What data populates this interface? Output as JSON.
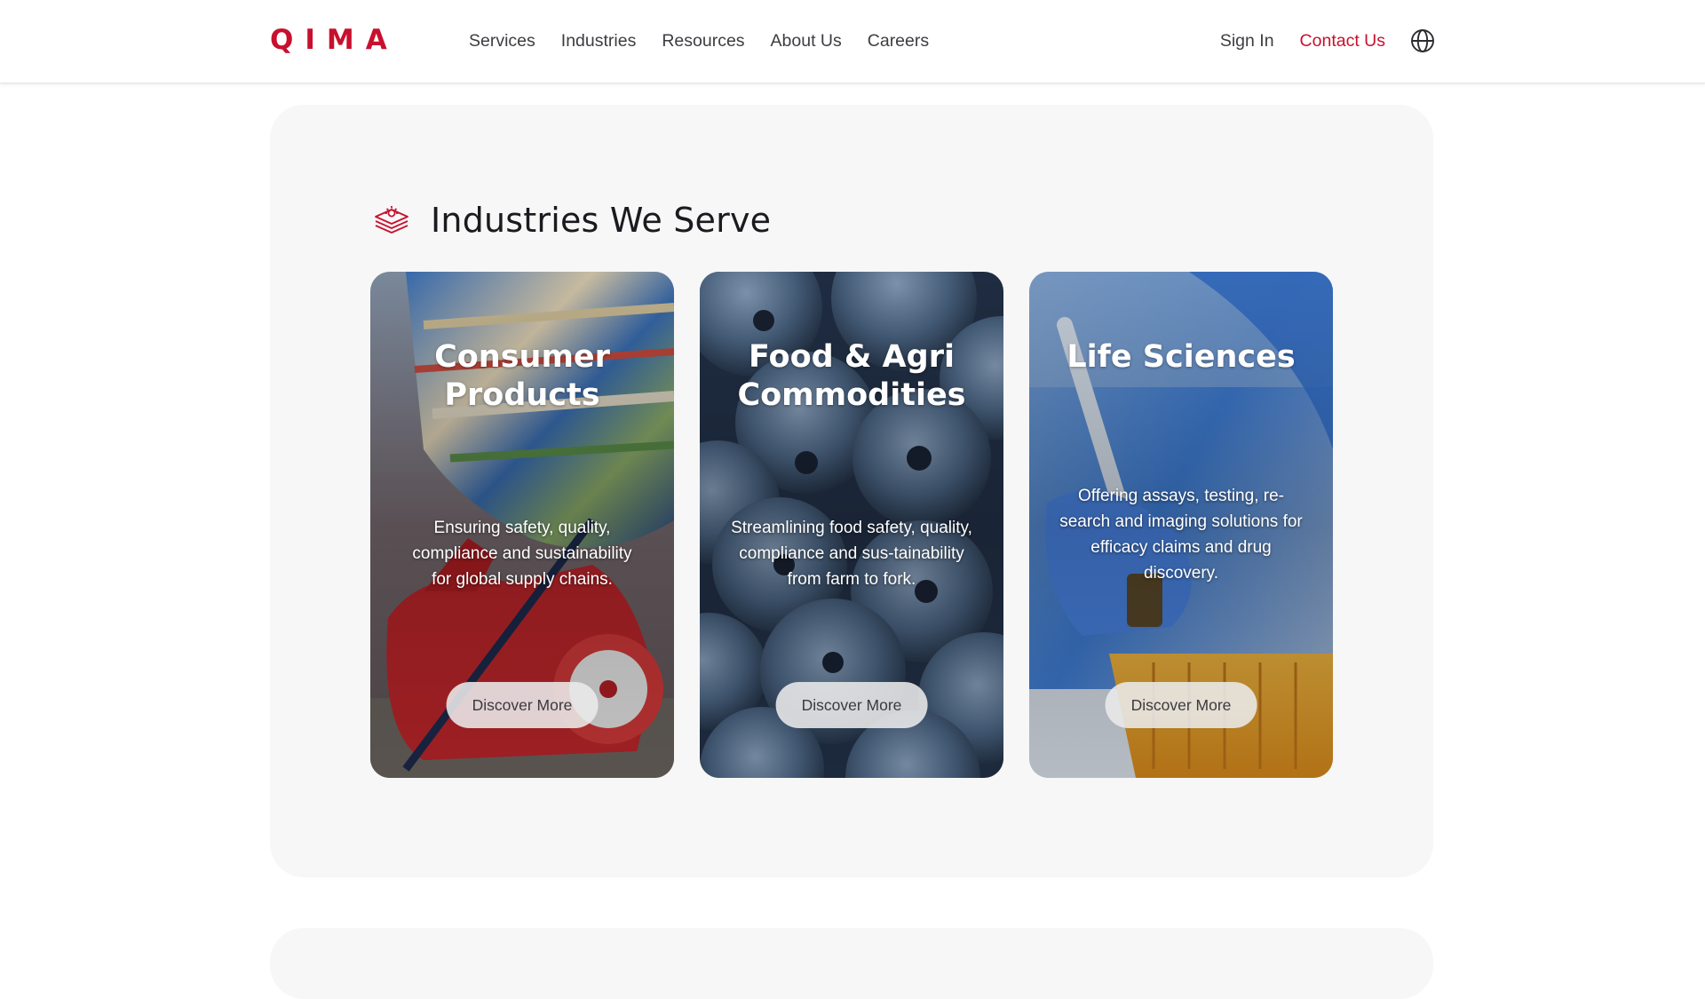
{
  "brand": {
    "logo_text": "QIMA",
    "accent": "#c8102e"
  },
  "nav": {
    "items": [
      {
        "label": "Services"
      },
      {
        "label": "Industries"
      },
      {
        "label": "Resources"
      },
      {
        "label": "About Us"
      },
      {
        "label": "Careers"
      }
    ],
    "sign_in": "Sign In",
    "contact": "Contact Us",
    "language_icon": "globe-icon"
  },
  "section": {
    "title": "Industries We Serve",
    "icon": "industries-stack-icon",
    "cards": [
      {
        "title": "Consumer Products",
        "description": "Ensuring safety, quality, compliance and sustainability for global supply chains.",
        "button": "Discover More"
      },
      {
        "title": "Food & Agri Commodities",
        "description": "Streamlining food safety, quality, compliance and sus-tainability from farm to fork.",
        "button": "Discover More"
      },
      {
        "title": "Life Sciences",
        "description": "Offering assays, testing, re-search and imaging solutions for efficacy claims and drug discovery.",
        "button": "Discover More"
      }
    ]
  }
}
